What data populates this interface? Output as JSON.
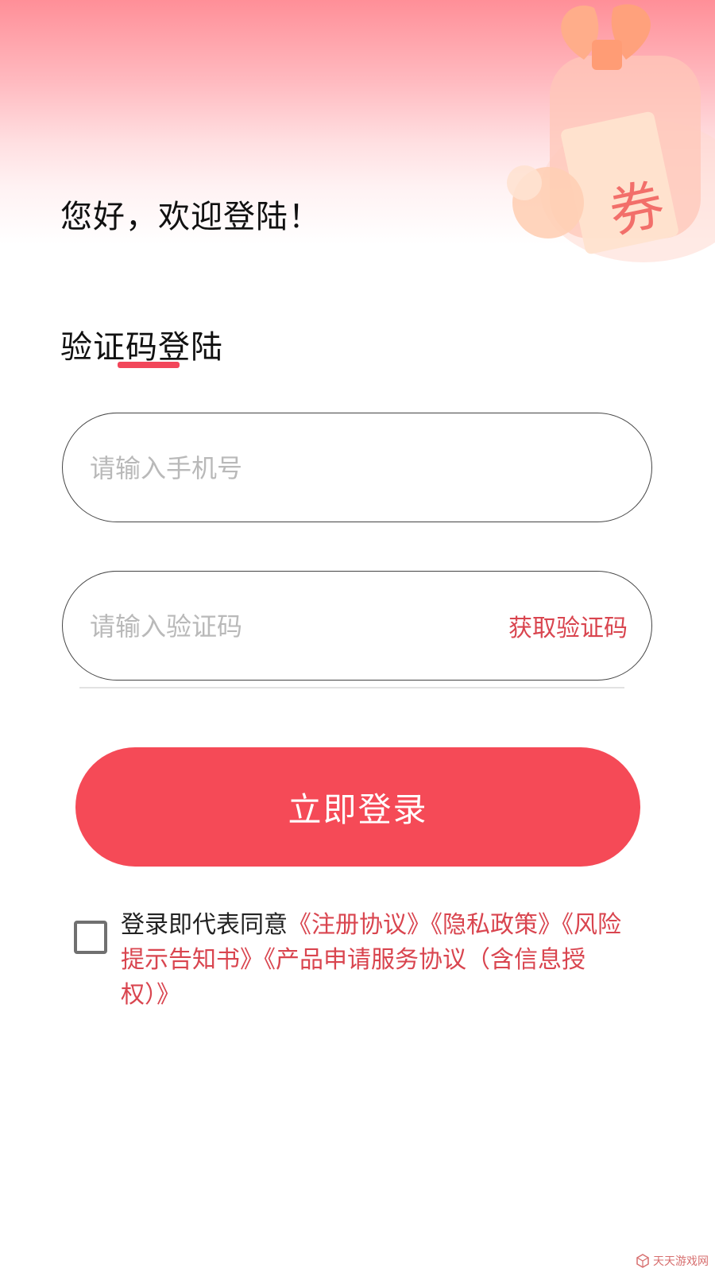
{
  "header": {
    "greeting": "您好，欢迎登陆！",
    "login_tab": "验证码登陆"
  },
  "illustration": {
    "coupon_text": "券"
  },
  "form": {
    "phone_placeholder": "请输入手机号",
    "code_placeholder": "请输入验证码",
    "get_code_label": "获取验证码",
    "submit_label": "立即登录"
  },
  "agreement": {
    "prefix": "登录即代表同意",
    "links": [
      "《注册协议》",
      "《隐私政策》",
      "《风险提示告知书》",
      "《产品申请服务协议（含信息授权）》"
    ],
    "checked": false
  },
  "watermark": {
    "text": "天天游戏网"
  },
  "colors": {
    "accent": "#f54a57",
    "link": "#d9454f",
    "placeholder": "#b9b9b9"
  }
}
